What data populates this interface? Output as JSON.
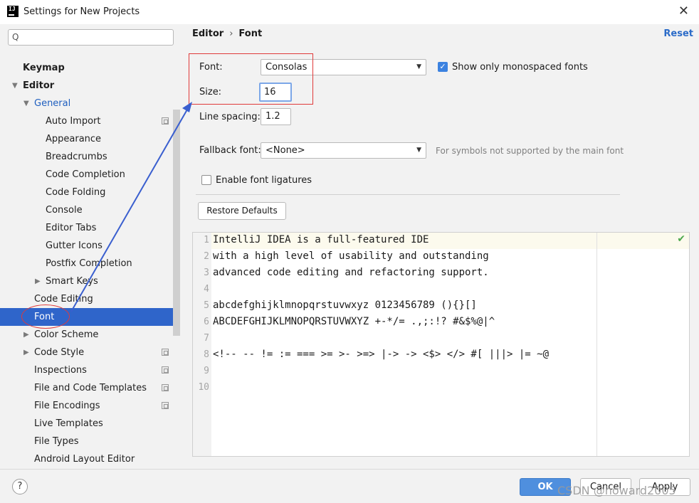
{
  "window": {
    "title": "Settings for New Projects",
    "app_icon_label": "IJ",
    "close_glyph": "✕"
  },
  "sidebar": {
    "search_placeholder": "Q",
    "items": [
      {
        "label": "Keymap"
      },
      {
        "label": "Editor"
      },
      {
        "label": "General"
      },
      {
        "label": "Auto Import"
      },
      {
        "label": "Appearance"
      },
      {
        "label": "Breadcrumbs"
      },
      {
        "label": "Code Completion"
      },
      {
        "label": "Code Folding"
      },
      {
        "label": "Console"
      },
      {
        "label": "Editor Tabs"
      },
      {
        "label": "Gutter Icons"
      },
      {
        "label": "Postfix Completion"
      },
      {
        "label": "Smart Keys"
      },
      {
        "label": "Code Editing"
      },
      {
        "label": "Font"
      },
      {
        "label": "Color Scheme"
      },
      {
        "label": "Code Style"
      },
      {
        "label": "Inspections"
      },
      {
        "label": "File and Code Templates"
      },
      {
        "label": "File Encodings"
      },
      {
        "label": "Live Templates"
      },
      {
        "label": "File Types"
      },
      {
        "label": "Android Layout Editor"
      }
    ]
  },
  "breadcrumb": {
    "parent": "Editor",
    "separator": "›",
    "current": "Font"
  },
  "reset_label": "Reset",
  "font_settings": {
    "font_label": "Font:",
    "font_value": "Consolas",
    "monospaced_label": "Show only monospaced fonts",
    "monospaced_checked": true,
    "size_label": "Size:",
    "size_value": "16",
    "line_spacing_label": "Line spacing:",
    "line_spacing_value": "1.2",
    "fallback_label": "Fallback font:",
    "fallback_value": "<None>",
    "fallback_hint": "For symbols not supported by the main font",
    "ligatures_label": "Enable font ligatures",
    "ligatures_checked": false,
    "restore_label": "Restore Defaults"
  },
  "preview": {
    "line_numbers": [
      "1",
      "2",
      "3",
      "4",
      "5",
      "6",
      "7",
      "8",
      "9",
      "10"
    ],
    "lines": [
      "IntelliJ IDEA is a full-featured IDE",
      "with a high level of usability and outstanding",
      "advanced code editing and refactoring support.",
      "",
      "abcdefghijklmnopqrstuvwxyz 0123456789 (){}[]",
      "ABCDEFGHIJKLMNOPQRSTUVWXYZ +-*/= .,;:!? #&$%@|^",
      "",
      "<!-- -- != := === >= >- >=> |-> -> <$> </> #[ |||> |= ~@",
      "",
      ""
    ],
    "check_glyph": "✔"
  },
  "footer": {
    "help_label": "?",
    "ok_label": "OK",
    "cancel_label": "Cancel",
    "apply_label": "Apply",
    "watermark": "CSDN @howard2005"
  },
  "colors": {
    "selection": "#2f65ca",
    "accent_link": "#2b6bc8",
    "annotation": "#e03a3a",
    "arrow": "#3a5fcf"
  }
}
